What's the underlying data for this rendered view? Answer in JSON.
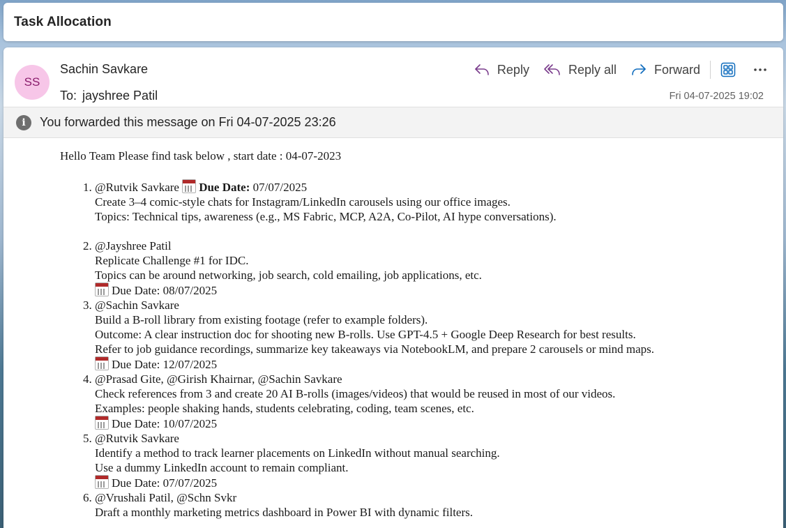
{
  "subject": "Task Allocation",
  "sender": {
    "initials": "SS",
    "name": "Sachin Savkare"
  },
  "recipients": {
    "label": "To:",
    "value": "jayshree Patil"
  },
  "actions": {
    "reply": "Reply",
    "reply_all": "Reply all",
    "forward": "Forward"
  },
  "datetime": "Fri 04-07-2025 19:02",
  "forward_notice": "You forwarded this message on Fri 04-07-2025 23:26",
  "colors": {
    "avatar_bg": "#f7c6e8",
    "avatar_text": "#8a1c6c",
    "accent": "#0f6cbd"
  },
  "body": {
    "greeting": "Hello Team Please find task below , start date : 04-07-2023",
    "tasks": [
      {
        "assignee": "@Rutvik Savkare",
        "due_inline_label": "Due Date:",
        "due_inline_date": "07/07/2025",
        "lines": [
          "Create 3–4 comic-style chats for Instagram/LinkedIn carousels using our office images.",
          "Topics: Technical tips, awareness (e.g., MS Fabric, MCP, A2A, Co-Pilot, AI hype conversations)."
        ]
      },
      {
        "assignee": "@Jayshree Patil",
        "lines": [
          "Replicate Challenge #1 for IDC.",
          "Topics can be around networking, job search, cold emailing, job applications, etc."
        ],
        "due": "Due Date: 08/07/2025"
      },
      {
        "assignee": "@Sachin Savkare",
        "lines": [
          "Build a B-roll library from existing footage (refer to example folders).",
          "Outcome: A clear instruction doc for shooting new B-rolls. Use GPT-4.5 + Google Deep Research for best results.",
          "Refer to job guidance recordings, summarize key takeaways via NotebookLM, and prepare 2 carousels or mind maps."
        ],
        "due": "Due Date: 12/07/2025"
      },
      {
        "assignee": "@Prasad Gite, @Girish Khairnar, @Sachin Savkare",
        "lines": [
          "Check references from 3 and create 20 AI B-rolls (images/videos) that would be reused in most of our videos.",
          "Examples: people shaking hands, students celebrating, coding, team scenes, etc."
        ],
        "due": "Due Date: 10/07/2025"
      },
      {
        "assignee": "@Rutvik Savkare",
        "lines": [
          "Identify a method to track learner placements on LinkedIn without manual searching.",
          "Use a dummy LinkedIn account to remain compliant."
        ],
        "due": "Due Date: 07/07/2025"
      },
      {
        "assignee": "@Vrushali Patil, @Schn Svkr",
        "lines": [
          "Draft a monthly marketing metrics dashboard in Power BI with dynamic filters."
        ]
      }
    ]
  }
}
